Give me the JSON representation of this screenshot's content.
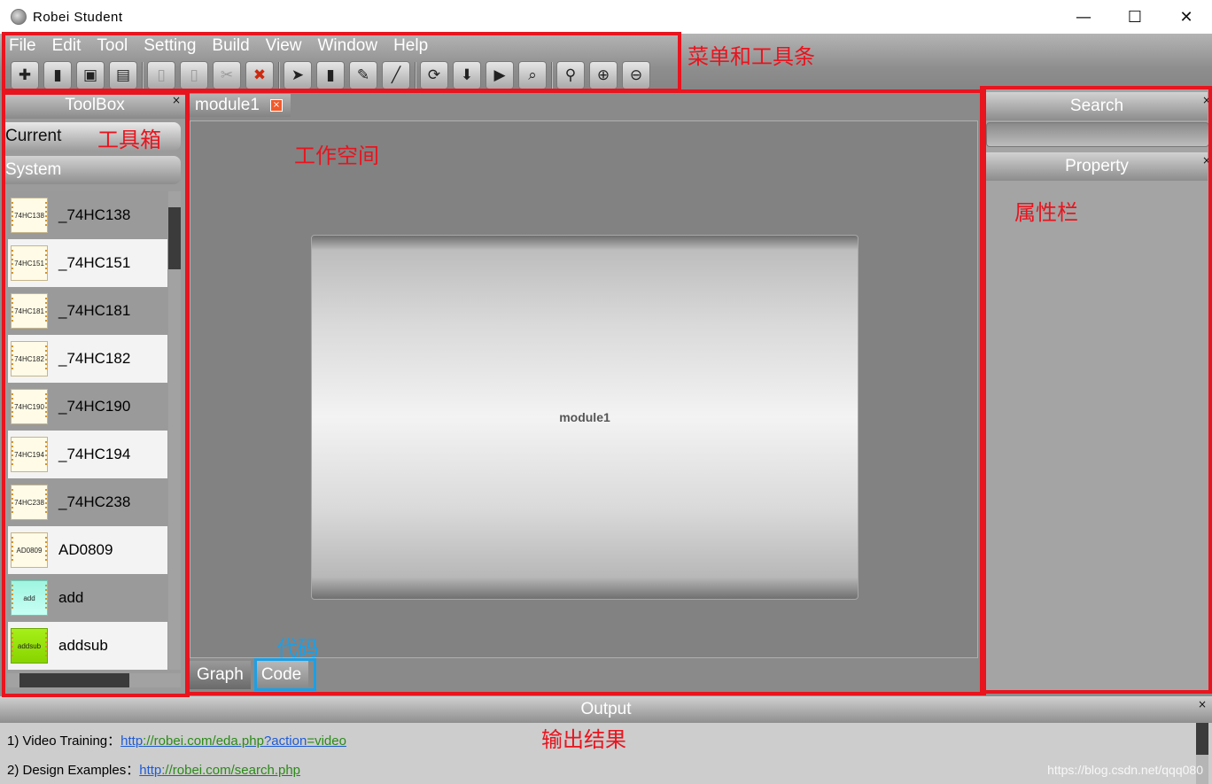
{
  "window": {
    "title": "Robei  Student",
    "minimize": "—",
    "maximize": "☐",
    "close": "✕"
  },
  "menu": [
    "File",
    "Edit",
    "Tool",
    "Setting",
    "Build",
    "View",
    "Window",
    "Help"
  ],
  "toolbar": {
    "groups": [
      [
        {
          "name": "new-icon",
          "glyph": "✚"
        },
        {
          "name": "open-icon",
          "glyph": "▮"
        },
        {
          "name": "save-icon",
          "glyph": "▣"
        },
        {
          "name": "save-all-icon",
          "glyph": "▤"
        }
      ],
      [
        {
          "name": "copy-icon",
          "glyph": "▯",
          "dim": true
        },
        {
          "name": "paste-icon",
          "glyph": "▯",
          "dim": true
        },
        {
          "name": "cut-icon",
          "glyph": "✂",
          "dim": true
        },
        {
          "name": "delete-icon",
          "glyph": "✖",
          "red": true
        }
      ],
      [
        {
          "name": "pointer-icon",
          "glyph": "➤"
        },
        {
          "name": "module-icon",
          "glyph": "▮"
        },
        {
          "name": "pin-icon",
          "glyph": "✎"
        },
        {
          "name": "wire-icon",
          "glyph": "╱"
        }
      ],
      [
        {
          "name": "run-icon",
          "glyph": "⟳"
        },
        {
          "name": "download-icon",
          "glyph": "⬇"
        },
        {
          "name": "simulate-icon",
          "glyph": "▶"
        },
        {
          "name": "inspect-icon",
          "glyph": "⌕"
        }
      ],
      [
        {
          "name": "zoom-fit-icon",
          "glyph": "⚲"
        },
        {
          "name": "zoom-in-icon",
          "glyph": "⊕"
        },
        {
          "name": "zoom-out-icon",
          "glyph": "⊖"
        }
      ]
    ]
  },
  "annotations": {
    "menu_toolbar": "菜单和工具条",
    "toolbox": "工具箱",
    "workspace": "工作空间",
    "property": "属性栏",
    "code": "代码",
    "output": "输出结果"
  },
  "toolbox": {
    "title": "ToolBox",
    "close": "×",
    "current": "Current",
    "system": "System",
    "items": [
      {
        "chip": "74HC138",
        "name": "_74HC138",
        "style": ""
      },
      {
        "chip": "74HC151",
        "name": "_74HC151",
        "style": ""
      },
      {
        "chip": "74HC181",
        "name": "_74HC181",
        "style": ""
      },
      {
        "chip": "74HC182",
        "name": "_74HC182",
        "style": ""
      },
      {
        "chip": "74HC190",
        "name": "_74HC190",
        "style": ""
      },
      {
        "chip": "74HC194",
        "name": "_74HC194",
        "style": ""
      },
      {
        "chip": "74HC238",
        "name": "_74HC238",
        "style": ""
      },
      {
        "chip": "AD0809",
        "name": "AD0809",
        "style": ""
      },
      {
        "chip": "add",
        "name": "add",
        "style": "add"
      },
      {
        "chip": "addsub",
        "name": "addsub",
        "style": "addsub"
      }
    ]
  },
  "workspace": {
    "tab_label": "module1",
    "tab_close": "×",
    "module_label": "module1",
    "bottom_tabs": [
      "Graph",
      "Code"
    ]
  },
  "search": {
    "title": "Search",
    "close": "×",
    "value": ""
  },
  "property": {
    "title": "Property",
    "close": "×"
  },
  "output": {
    "title": "Output",
    "close": "×",
    "lines": [
      {
        "prefix": "1) Video Training：",
        "link_a": "http",
        "link_b": "://robei.com/eda.php",
        "link_c": "?action",
        "link_d": "=video"
      },
      {
        "prefix": "2) Design Examples：",
        "link_a": "http",
        "link_b": "://robei.com/search.php",
        "link_c": "",
        "link_d": ""
      }
    ]
  },
  "watermark": "https://blog.csdn.net/qqq080",
  "colors": {
    "annotation_red": "#e8141e",
    "annotation_blue": "#1aa0e8"
  }
}
